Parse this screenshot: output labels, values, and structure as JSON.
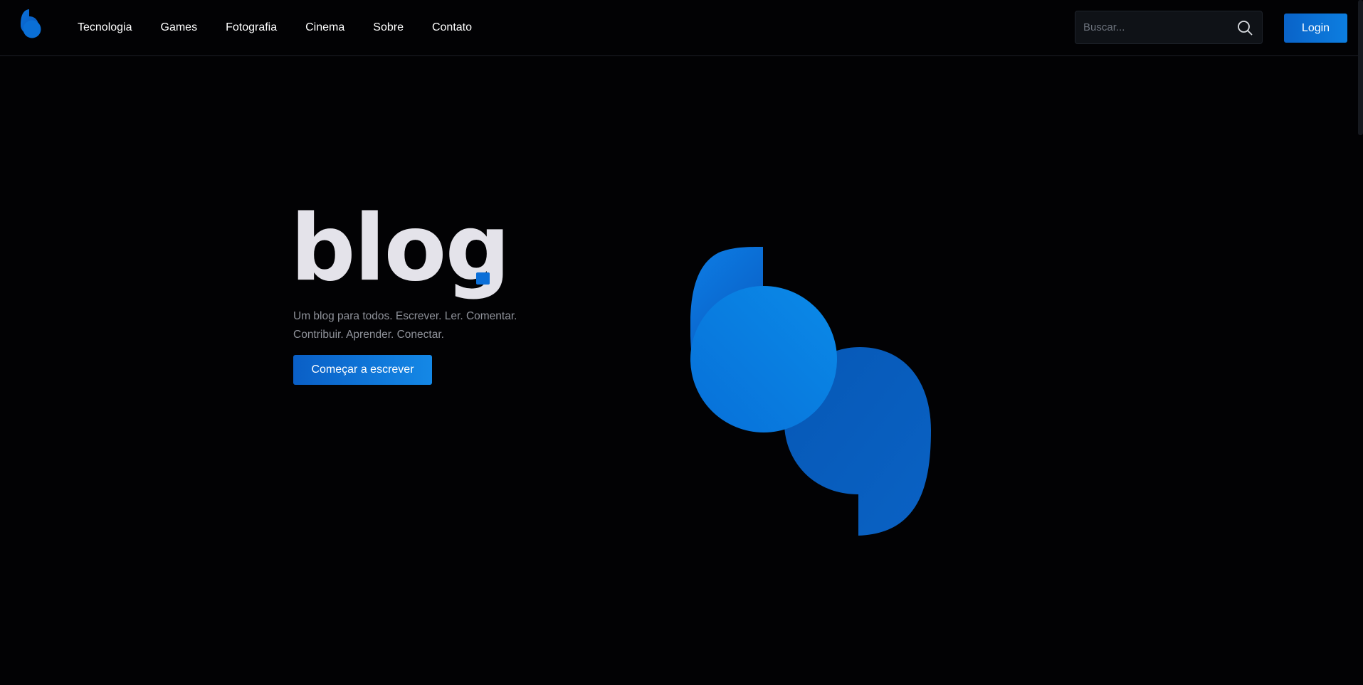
{
  "nav": {
    "items": [
      "Tecnologia",
      "Games",
      "Fotografia",
      "Cinema",
      "Sobre",
      "Contato"
    ]
  },
  "search": {
    "placeholder": "Buscar..."
  },
  "header": {
    "login_label": "Login"
  },
  "hero": {
    "title": "blog",
    "subtitle_line1": "Um blog para todos. Escrever. Ler. Comentar.",
    "subtitle_line2": "Contribuir. Aprender. Conectar.",
    "cta_label": "Começar a escrever"
  },
  "colors": {
    "background": "#020204",
    "accent": "#0b6fd8",
    "title": "#e4e3ea",
    "subtitle": "#8f929a"
  },
  "icons": {
    "logo": "b-logo-icon",
    "search": "search-icon",
    "hero_art": "b-logo-illustration"
  }
}
